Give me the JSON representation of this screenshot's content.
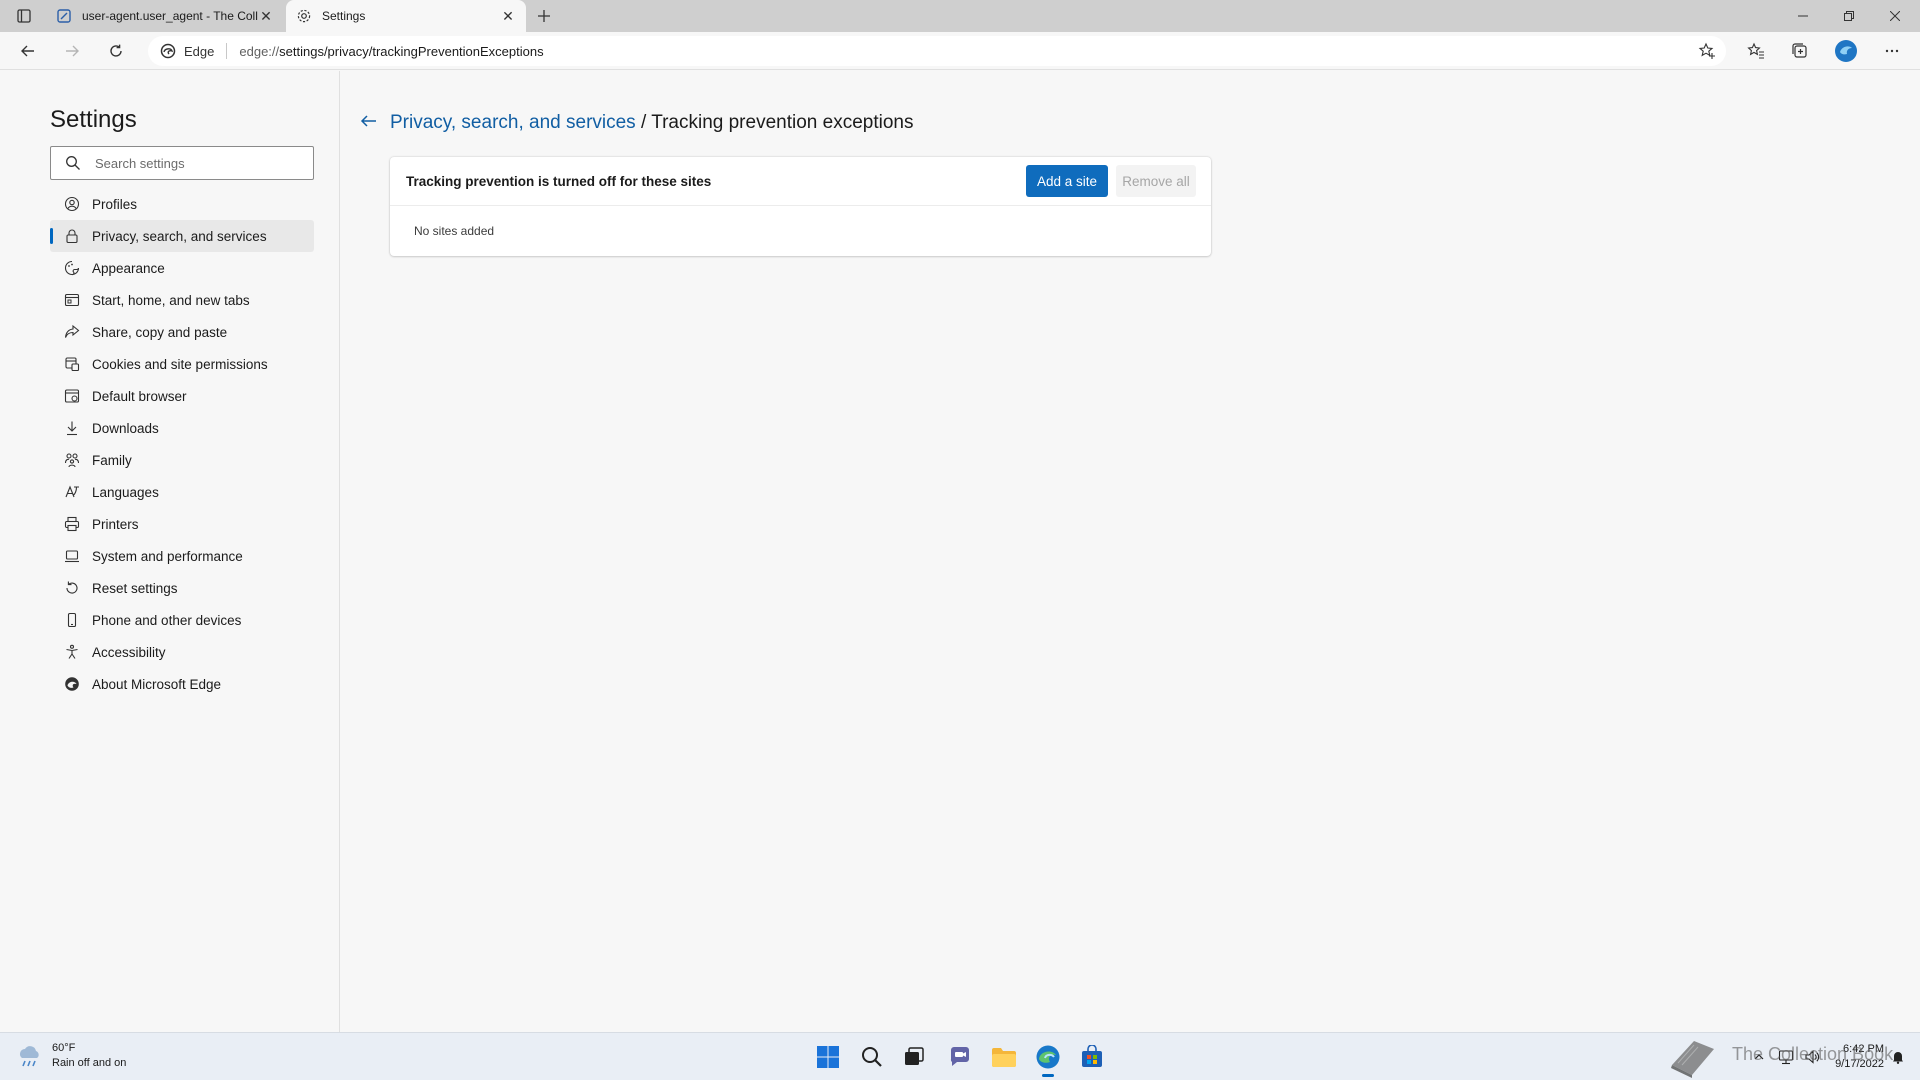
{
  "browser": {
    "tabs": [
      {
        "title": "user-agent.user_agent - The Coll",
        "icon": "page-icon",
        "active": false
      },
      {
        "title": "Settings",
        "icon": "gear-icon",
        "active": true
      }
    ],
    "edge_label": "Edge",
    "url_prefix": "edge://",
    "url_rest": "settings/privacy/trackingPreventionExceptions"
  },
  "sidebar": {
    "title": "Settings",
    "search_placeholder": "Search settings",
    "items": [
      {
        "label": "Profiles",
        "icon": "profile-icon"
      },
      {
        "label": "Privacy, search, and services",
        "icon": "lock-icon",
        "selected": true
      },
      {
        "label": "Appearance",
        "icon": "appearance-icon"
      },
      {
        "label": "Start, home, and new tabs",
        "icon": "home-tabs-icon"
      },
      {
        "label": "Share, copy and paste",
        "icon": "share-icon"
      },
      {
        "label": "Cookies and site permissions",
        "icon": "cookies-icon"
      },
      {
        "label": "Default browser",
        "icon": "default-browser-icon"
      },
      {
        "label": "Downloads",
        "icon": "download-icon"
      },
      {
        "label": "Family",
        "icon": "family-icon"
      },
      {
        "label": "Languages",
        "icon": "languages-icon"
      },
      {
        "label": "Printers",
        "icon": "printer-icon"
      },
      {
        "label": "System and performance",
        "icon": "laptop-icon"
      },
      {
        "label": "Reset settings",
        "icon": "reset-icon"
      },
      {
        "label": "Phone and other devices",
        "icon": "phone-icon"
      },
      {
        "label": "Accessibility",
        "icon": "accessibility-icon"
      },
      {
        "label": "About Microsoft Edge",
        "icon": "edge-logo-icon"
      }
    ]
  },
  "main": {
    "breadcrumb_parent": "Privacy, search, and services",
    "breadcrumb_sep": " / ",
    "breadcrumb_current": "Tracking prevention exceptions",
    "card_title": "Tracking prevention is turned off for these sites",
    "add_button": "Add a site",
    "remove_button": "Remove all",
    "empty_text": "No sites added"
  },
  "taskbar": {
    "weather_temp": "60°F",
    "weather_desc": "Rain off and on",
    "time": "6:42 PM",
    "date": "9/17/2022",
    "watermark": "The Collection Book"
  },
  "colors": {
    "accent": "#0f6cbd",
    "link": "#115ea3",
    "selected_bg": "#e8e8e8"
  }
}
